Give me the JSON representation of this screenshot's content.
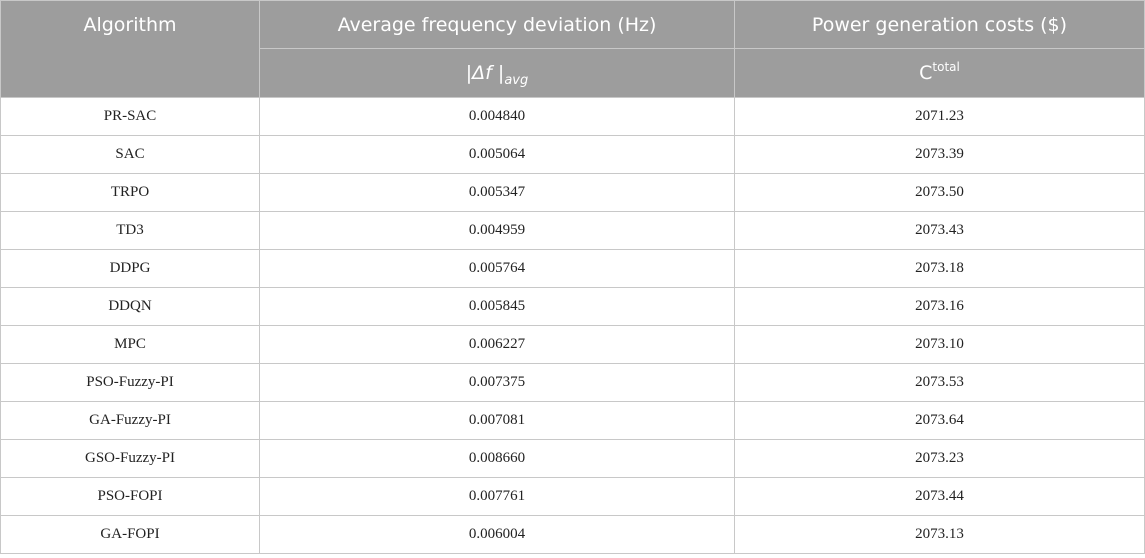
{
  "header": {
    "col_algorithm": "Algorithm",
    "col_freq": "Average frequency deviation (Hz)",
    "col_cost": "Power generation costs ($)",
    "freq_symbol": {
      "open": "|",
      "delta": "Δf",
      "close": " |",
      "sub": "avg"
    },
    "cost_symbol": {
      "base": "C",
      "sup": "total"
    }
  },
  "rows": [
    {
      "algorithm": "PR-SAC",
      "freq": "0.004840",
      "cost": "2071.23"
    },
    {
      "algorithm": "SAC",
      "freq": "0.005064",
      "cost": "2073.39"
    },
    {
      "algorithm": "TRPO",
      "freq": "0.005347",
      "cost": "2073.50"
    },
    {
      "algorithm": "TD3",
      "freq": "0.004959",
      "cost": "2073.43"
    },
    {
      "algorithm": "DDPG",
      "freq": "0.005764",
      "cost": "2073.18"
    },
    {
      "algorithm": "DDQN",
      "freq": "0.005845",
      "cost": "2073.16"
    },
    {
      "algorithm": "MPC",
      "freq": "0.006227",
      "cost": "2073.10"
    },
    {
      "algorithm": "PSO-Fuzzy-PI",
      "freq": "0.007375",
      "cost": "2073.53"
    },
    {
      "algorithm": "GA-Fuzzy-PI",
      "freq": "0.007081",
      "cost": "2073.64"
    },
    {
      "algorithm": "GSO-Fuzzy-PI",
      "freq": "0.008660",
      "cost": "2073.23"
    },
    {
      "algorithm": "PSO-FOPI",
      "freq": "0.007761",
      "cost": "2073.44"
    },
    {
      "algorithm": "GA-FOPI",
      "freq": "0.006004",
      "cost": "2073.13"
    }
  ]
}
